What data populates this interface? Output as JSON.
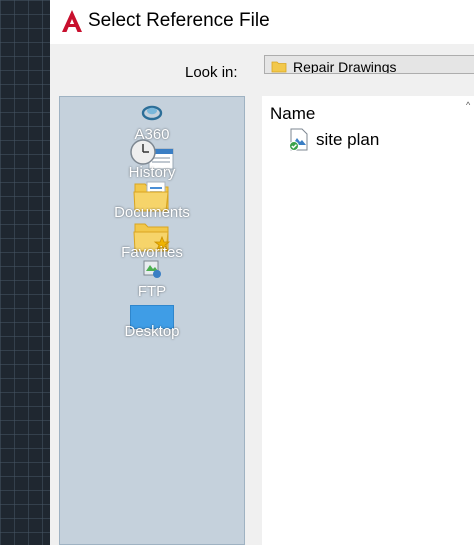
{
  "dialog": {
    "title": "Select Reference File",
    "look_in_label": "Look in:",
    "look_in_value": "Repair Drawings"
  },
  "places": [
    {
      "label": "A360",
      "icon": "a360-cloud-icon"
    },
    {
      "label": "History",
      "icon": "history-clock-icon"
    },
    {
      "label": "Documents",
      "icon": "documents-folder-icon"
    },
    {
      "label": "Favorites",
      "icon": "favorites-folder-icon"
    },
    {
      "label": "FTP",
      "icon": "ftp-icon"
    },
    {
      "label": "Desktop",
      "icon": "desktop-icon"
    }
  ],
  "file_list": {
    "column_name": "Name",
    "sort_indicator": "^",
    "files": [
      {
        "name": "site plan",
        "icon": "drawing-file-icon"
      }
    ]
  },
  "colors": {
    "accent_red": "#c8102e",
    "places_bg": "#c5d1dc",
    "folder_yellow": "#f2c84b"
  }
}
